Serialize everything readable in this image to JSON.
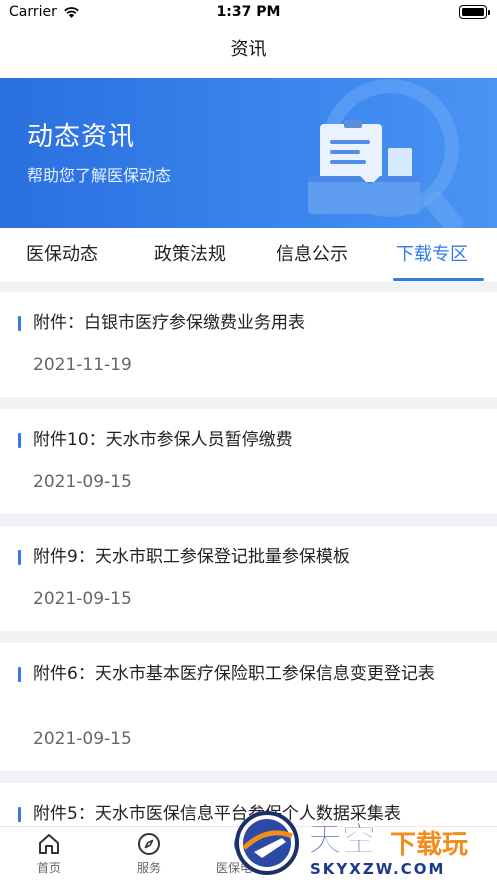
{
  "status_bar": {
    "carrier": "Carrier",
    "time": "1:37 PM"
  },
  "nav": {
    "title": "资讯"
  },
  "banner": {
    "title": "动态资讯",
    "subtitle": "帮助您了解医保动态"
  },
  "tabs": [
    {
      "label": "医保动态",
      "active": false
    },
    {
      "label": "政策法规",
      "active": false
    },
    {
      "label": "信息公示",
      "active": false
    },
    {
      "label": "下载专区",
      "active": true
    }
  ],
  "articles": [
    {
      "title": "附件：白银市医疗参保缴费业务用表",
      "date": "2021-11-19"
    },
    {
      "title": "附件10：天水市参保人员暂停缴费",
      "date": "2021-09-15"
    },
    {
      "title": "附件9：天水市职工参保登记批量参保模板",
      "date": "2021-09-15"
    },
    {
      "title": "附件6：天水市基本医疗保险职工参保信息变更登记表",
      "date": "2021-09-15"
    },
    {
      "title": "附件5：天水市医保信息平台参保个人数据采集表",
      "date": ""
    }
  ],
  "tabbar": [
    {
      "label": "首页",
      "icon": "home-icon"
    },
    {
      "label": "服务",
      "icon": "compass-icon"
    },
    {
      "label": "医保电",
      "icon": "card-icon"
    }
  ],
  "watermark": {
    "brand": "天空",
    "suffix": "下载玩",
    "url": "SKYXZW.COM"
  },
  "colors": {
    "accent": "#2f7be8",
    "banner": "#3a86ee",
    "background": "#f1f2f6"
  }
}
